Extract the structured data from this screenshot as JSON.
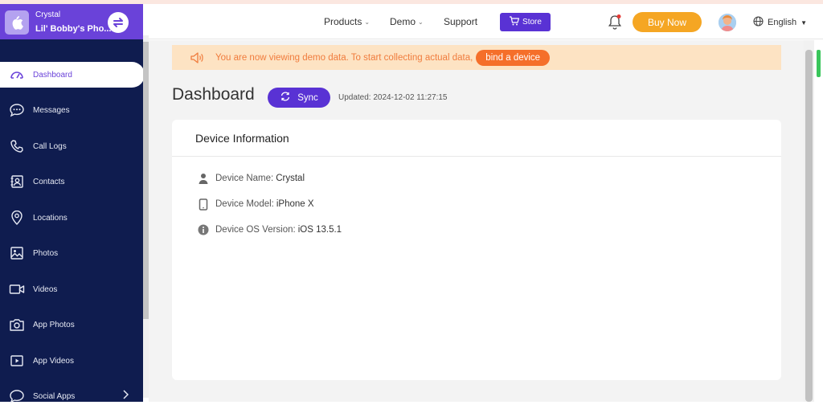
{
  "device": {
    "name": "Crystal",
    "subtitle": "Lil' Bobby's Pho..."
  },
  "sidebar": {
    "items": [
      {
        "label": "Dashboard",
        "icon": "gauge-icon",
        "active": true
      },
      {
        "label": "Messages",
        "icon": "chat-bubble-icon"
      },
      {
        "label": "Call Logs",
        "icon": "phone-icon"
      },
      {
        "label": "Contacts",
        "icon": "contact-book-icon"
      },
      {
        "label": "Locations",
        "icon": "location-pin-icon"
      },
      {
        "label": "Photos",
        "icon": "image-icon"
      },
      {
        "label": "Videos",
        "icon": "video-camera-icon"
      },
      {
        "label": "App Photos",
        "icon": "camera-icon"
      },
      {
        "label": "App Videos",
        "icon": "play-box-icon"
      },
      {
        "label": "Social Apps",
        "icon": "social-bubble-icon"
      }
    ]
  },
  "topbar": {
    "products": "Products",
    "demo": "Demo",
    "support": "Support",
    "store": "Store",
    "buy_now": "Buy Now",
    "language": "English"
  },
  "banner": {
    "text": "You are now viewing demo data. To start collecting actual data,",
    "button": "bind a device"
  },
  "page": {
    "title": "Dashboard",
    "sync": "Sync",
    "updated": "Updated: 2024-12-02 11:27:15"
  },
  "card": {
    "title": "Device Information",
    "rows": [
      {
        "label": "Device Name:",
        "value": "Crystal",
        "icon": "person-icon"
      },
      {
        "label": "Device Model:",
        "value": "iPhone X",
        "icon": "phone-device-icon"
      },
      {
        "label": "Device OS Version:",
        "value": "iOS 13.5.1",
        "icon": "info-icon"
      }
    ]
  },
  "colors": {
    "sidebar_bg": "#0f1c4f",
    "accent_purple": "#5932d4",
    "buy_orange": "#f5a623",
    "banner_bg": "#fde3c3",
    "banner_text": "#f07c3d"
  }
}
